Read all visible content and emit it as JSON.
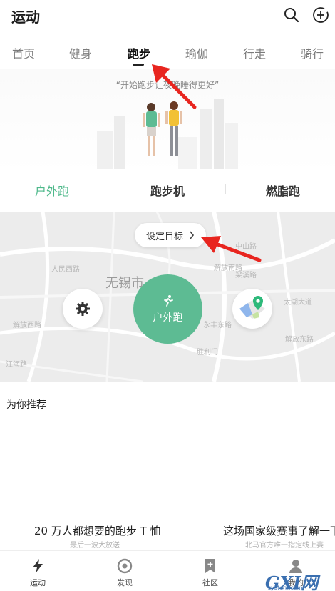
{
  "header": {
    "title": "运动",
    "icons": [
      "search-icon",
      "add-circle-icon"
    ]
  },
  "tabs": [
    {
      "label": "首页",
      "active": false
    },
    {
      "label": "健身",
      "active": false
    },
    {
      "label": "跑步",
      "active": true
    },
    {
      "label": "瑜伽",
      "active": false
    },
    {
      "label": "行走",
      "active": false
    },
    {
      "label": "骑行",
      "active": false
    }
  ],
  "hero": {
    "slogan": "“开始跑步让夜晚睡得更好”"
  },
  "modes": [
    {
      "label": "户外跑",
      "active": true
    },
    {
      "label": "跑步机",
      "active": false
    },
    {
      "label": "燃脂跑",
      "active": false
    }
  ],
  "map": {
    "goal_label": "设定目标",
    "city_label": "无锡市",
    "start_label": "户外跑",
    "street_labels": [
      "人民西路",
      "中山路",
      "解放西路",
      "解放南路",
      "永丰东路",
      "梁溪路",
      "太湖大道",
      "江海路",
      "解放东路",
      "胜利门"
    ]
  },
  "recommend": {
    "title": "为你推荐",
    "cards": [
      {
        "title": "20 万人都想要的跑步 T 恤",
        "subtitle": "最后一波大放送"
      },
      {
        "title": "这场国家级赛事了解一下",
        "subtitle": "北马官方唯一指定线上赛"
      }
    ]
  },
  "bottom_nav": [
    {
      "label": "运动",
      "icon": "lightning-icon",
      "active": true
    },
    {
      "label": "发现",
      "icon": "discover-icon",
      "active": false
    },
    {
      "label": "社区",
      "icon": "bookmark-icon",
      "active": false
    },
    {
      "label": "我的",
      "icon": "profile-icon",
      "active": false
    }
  ],
  "watermark": {
    "text": "GXI网",
    "sub": "system.com"
  },
  "colors": {
    "accent": "#5dbb93",
    "accent_text": "#4fb98b",
    "annotation": "#e8251f"
  }
}
